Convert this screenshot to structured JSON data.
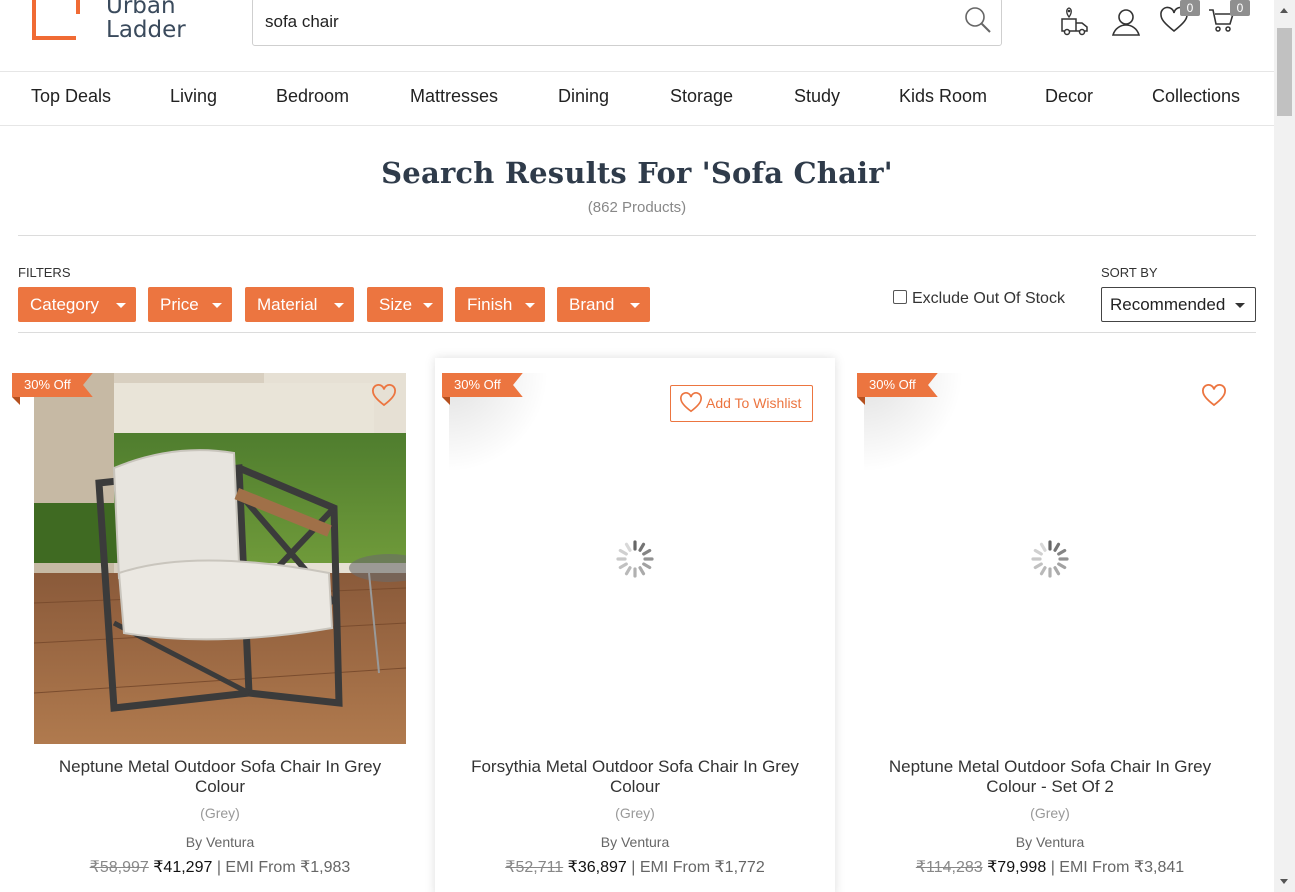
{
  "header": {
    "logo_line1": "Urban",
    "logo_line2": "Ladder",
    "search_value": "sofa chair",
    "wishlist_count": "0",
    "cart_count": "0"
  },
  "nav": {
    "items": [
      "Top Deals",
      "Living",
      "Bedroom",
      "Mattresses",
      "Dining",
      "Storage",
      "Study",
      "Kids Room",
      "Decor",
      "Collections"
    ]
  },
  "results": {
    "title": "Search Results For 'Sofa Chair'",
    "count": "(862 Products)"
  },
  "filters": {
    "label": "FILTERS",
    "buttons": [
      "Category",
      "Price",
      "Material",
      "Size",
      "Finish",
      "Brand"
    ],
    "exclude_label": "Exclude Out Of Stock",
    "exclude_checked": false,
    "sort_label": "SORT BY",
    "sort_value": "Recommended"
  },
  "products": [
    {
      "discount": "30% Off",
      "name": "Neptune Metal Outdoor Sofa Chair In Grey Colour",
      "variant": "(Grey)",
      "brand": "By Ventura",
      "mrp": "₹58,997",
      "price": "₹41,297",
      "emi": "| EMI From ₹1,983"
    },
    {
      "discount": "30% Off",
      "wishlist_label": "Add To Wishlist",
      "name": "Forsythia Metal Outdoor Sofa Chair In Grey Colour",
      "variant": "(Grey)",
      "brand": "By Ventura",
      "mrp": "₹52,711",
      "price": "₹36,897",
      "emi": "| EMI From ₹1,772"
    },
    {
      "discount": "30% Off",
      "name": "Neptune Metal Outdoor Sofa Chair In Grey Colour - Set Of 2",
      "variant": "(Grey)",
      "brand": "By Ventura",
      "mrp": "₹114,283",
      "price": "₹79,998",
      "emi": "| EMI From ₹3,841"
    }
  ],
  "colors": {
    "accent": "#ec7540",
    "text": "#333333"
  }
}
